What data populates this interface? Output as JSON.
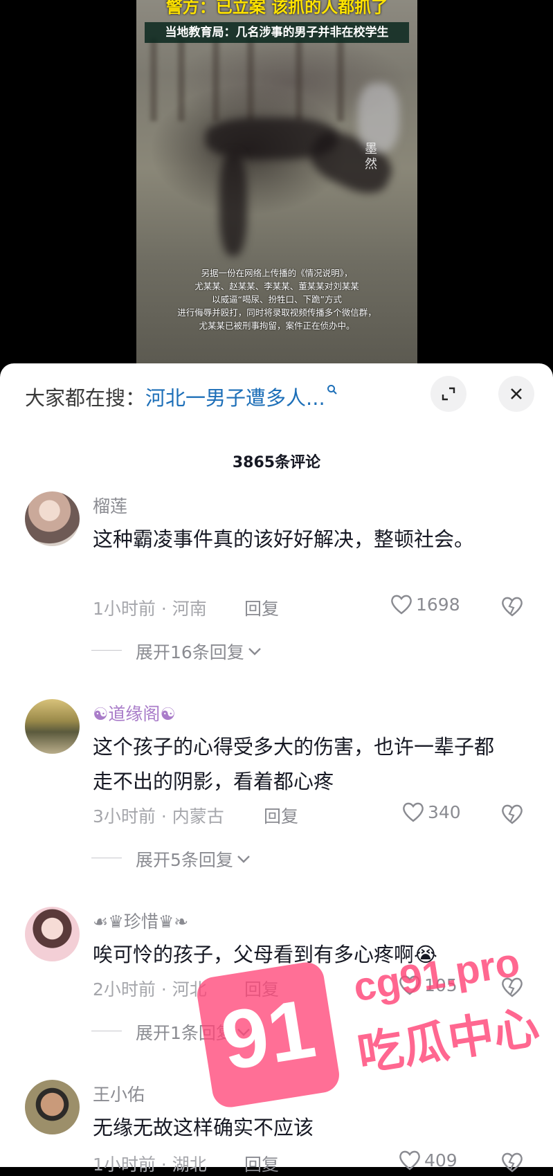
{
  "video": {
    "headline_top": "警方：已立案 该抓的人都抓了",
    "headline_sub": "当地教育局：几名涉事的男子并非在校学生",
    "side_mark": "墨然",
    "caption_lines": [
      "另据一份在网络上传播的《情况说明》，",
      "尤某某、赵某某、李某某、董某某对刘某某",
      "以威逼“喝尿、扮牲口、下跪”方式",
      "进行侮辱并殴打，同时将录取视频传播多个微信群，",
      "尤某某已被刑事拘留，案件正在侦办中。"
    ]
  },
  "search": {
    "prefix": "大家都在搜：",
    "term": "河北一男子遭多人..."
  },
  "comment_count": "3865条评论",
  "comments": [
    {
      "name": "榴莲",
      "text": "这种霸凌事件真的该好好解决，整顿社会。",
      "time_loc": "1小时前 · 河南",
      "reply": "回复",
      "likes": "1698",
      "expand": "展开16条回复"
    },
    {
      "name": "☯道缘阁☯",
      "text": "这个孩子的心得受多大的伤害，也许一辈子都走不出的阴影，看着都心疼",
      "time_loc": "3小时前 · 内蒙古",
      "reply": "回复",
      "likes": "340",
      "expand": "展开5条回复"
    },
    {
      "name": "☙♛珍惜♛❧",
      "text": "唉可怜的孩子，父母看到有多心疼啊😭",
      "time_loc": "2小时前 · 河北",
      "reply": "回复",
      "likes": "105",
      "expand": "展开1条回复"
    },
    {
      "name": "王小佑",
      "text": "无缘无故这样确实不应该",
      "time_loc": "1小时前 · 湖北",
      "reply": "回复",
      "likes": "409"
    }
  ],
  "watermark": {
    "badge": "91",
    "site": "cg91.pro",
    "name": "吃瓜中心"
  },
  "colors": {
    "link_blue": "#1d6fb8",
    "watermark_pink": "#ff4678",
    "caption_bar": "#0a281e"
  },
  "icons": [
    "search-icon",
    "expand-icon",
    "close-icon",
    "heart-icon",
    "broken-heart-icon",
    "chevron-down-icon"
  ]
}
